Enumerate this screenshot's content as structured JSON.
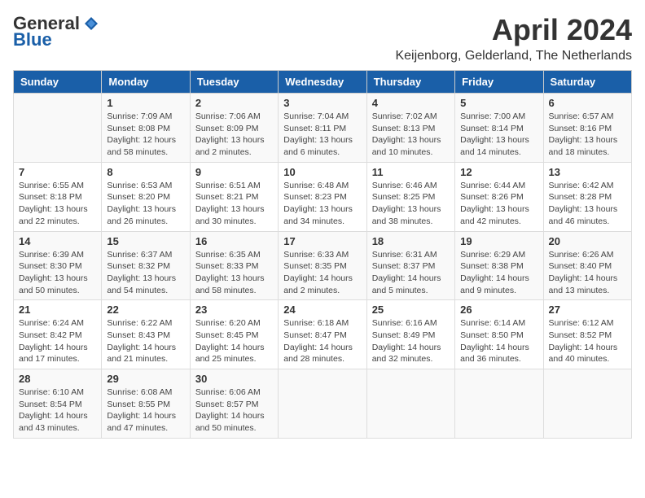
{
  "header": {
    "logo_general": "General",
    "logo_blue": "Blue",
    "month_year": "April 2024",
    "location": "Keijenborg, Gelderland, The Netherlands"
  },
  "calendar": {
    "days_of_week": [
      "Sunday",
      "Monday",
      "Tuesday",
      "Wednesday",
      "Thursday",
      "Friday",
      "Saturday"
    ],
    "weeks": [
      [
        {
          "day": "",
          "info": ""
        },
        {
          "day": "1",
          "info": "Sunrise: 7:09 AM\nSunset: 8:08 PM\nDaylight: 12 hours\nand 58 minutes."
        },
        {
          "day": "2",
          "info": "Sunrise: 7:06 AM\nSunset: 8:09 PM\nDaylight: 13 hours\nand 2 minutes."
        },
        {
          "day": "3",
          "info": "Sunrise: 7:04 AM\nSunset: 8:11 PM\nDaylight: 13 hours\nand 6 minutes."
        },
        {
          "day": "4",
          "info": "Sunrise: 7:02 AM\nSunset: 8:13 PM\nDaylight: 13 hours\nand 10 minutes."
        },
        {
          "day": "5",
          "info": "Sunrise: 7:00 AM\nSunset: 8:14 PM\nDaylight: 13 hours\nand 14 minutes."
        },
        {
          "day": "6",
          "info": "Sunrise: 6:57 AM\nSunset: 8:16 PM\nDaylight: 13 hours\nand 18 minutes."
        }
      ],
      [
        {
          "day": "7",
          "info": "Sunrise: 6:55 AM\nSunset: 8:18 PM\nDaylight: 13 hours\nand 22 minutes."
        },
        {
          "day": "8",
          "info": "Sunrise: 6:53 AM\nSunset: 8:20 PM\nDaylight: 13 hours\nand 26 minutes."
        },
        {
          "day": "9",
          "info": "Sunrise: 6:51 AM\nSunset: 8:21 PM\nDaylight: 13 hours\nand 30 minutes."
        },
        {
          "day": "10",
          "info": "Sunrise: 6:48 AM\nSunset: 8:23 PM\nDaylight: 13 hours\nand 34 minutes."
        },
        {
          "day": "11",
          "info": "Sunrise: 6:46 AM\nSunset: 8:25 PM\nDaylight: 13 hours\nand 38 minutes."
        },
        {
          "day": "12",
          "info": "Sunrise: 6:44 AM\nSunset: 8:26 PM\nDaylight: 13 hours\nand 42 minutes."
        },
        {
          "day": "13",
          "info": "Sunrise: 6:42 AM\nSunset: 8:28 PM\nDaylight: 13 hours\nand 46 minutes."
        }
      ],
      [
        {
          "day": "14",
          "info": "Sunrise: 6:39 AM\nSunset: 8:30 PM\nDaylight: 13 hours\nand 50 minutes."
        },
        {
          "day": "15",
          "info": "Sunrise: 6:37 AM\nSunset: 8:32 PM\nDaylight: 13 hours\nand 54 minutes."
        },
        {
          "day": "16",
          "info": "Sunrise: 6:35 AM\nSunset: 8:33 PM\nDaylight: 13 hours\nand 58 minutes."
        },
        {
          "day": "17",
          "info": "Sunrise: 6:33 AM\nSunset: 8:35 PM\nDaylight: 14 hours\nand 2 minutes."
        },
        {
          "day": "18",
          "info": "Sunrise: 6:31 AM\nSunset: 8:37 PM\nDaylight: 14 hours\nand 5 minutes."
        },
        {
          "day": "19",
          "info": "Sunrise: 6:29 AM\nSunset: 8:38 PM\nDaylight: 14 hours\nand 9 minutes."
        },
        {
          "day": "20",
          "info": "Sunrise: 6:26 AM\nSunset: 8:40 PM\nDaylight: 14 hours\nand 13 minutes."
        }
      ],
      [
        {
          "day": "21",
          "info": "Sunrise: 6:24 AM\nSunset: 8:42 PM\nDaylight: 14 hours\nand 17 minutes."
        },
        {
          "day": "22",
          "info": "Sunrise: 6:22 AM\nSunset: 8:43 PM\nDaylight: 14 hours\nand 21 minutes."
        },
        {
          "day": "23",
          "info": "Sunrise: 6:20 AM\nSunset: 8:45 PM\nDaylight: 14 hours\nand 25 minutes."
        },
        {
          "day": "24",
          "info": "Sunrise: 6:18 AM\nSunset: 8:47 PM\nDaylight: 14 hours\nand 28 minutes."
        },
        {
          "day": "25",
          "info": "Sunrise: 6:16 AM\nSunset: 8:49 PM\nDaylight: 14 hours\nand 32 minutes."
        },
        {
          "day": "26",
          "info": "Sunrise: 6:14 AM\nSunset: 8:50 PM\nDaylight: 14 hours\nand 36 minutes."
        },
        {
          "day": "27",
          "info": "Sunrise: 6:12 AM\nSunset: 8:52 PM\nDaylight: 14 hours\nand 40 minutes."
        }
      ],
      [
        {
          "day": "28",
          "info": "Sunrise: 6:10 AM\nSunset: 8:54 PM\nDaylight: 14 hours\nand 43 minutes."
        },
        {
          "day": "29",
          "info": "Sunrise: 6:08 AM\nSunset: 8:55 PM\nDaylight: 14 hours\nand 47 minutes."
        },
        {
          "day": "30",
          "info": "Sunrise: 6:06 AM\nSunset: 8:57 PM\nDaylight: 14 hours\nand 50 minutes."
        },
        {
          "day": "",
          "info": ""
        },
        {
          "day": "",
          "info": ""
        },
        {
          "day": "",
          "info": ""
        },
        {
          "day": "",
          "info": ""
        }
      ]
    ]
  }
}
